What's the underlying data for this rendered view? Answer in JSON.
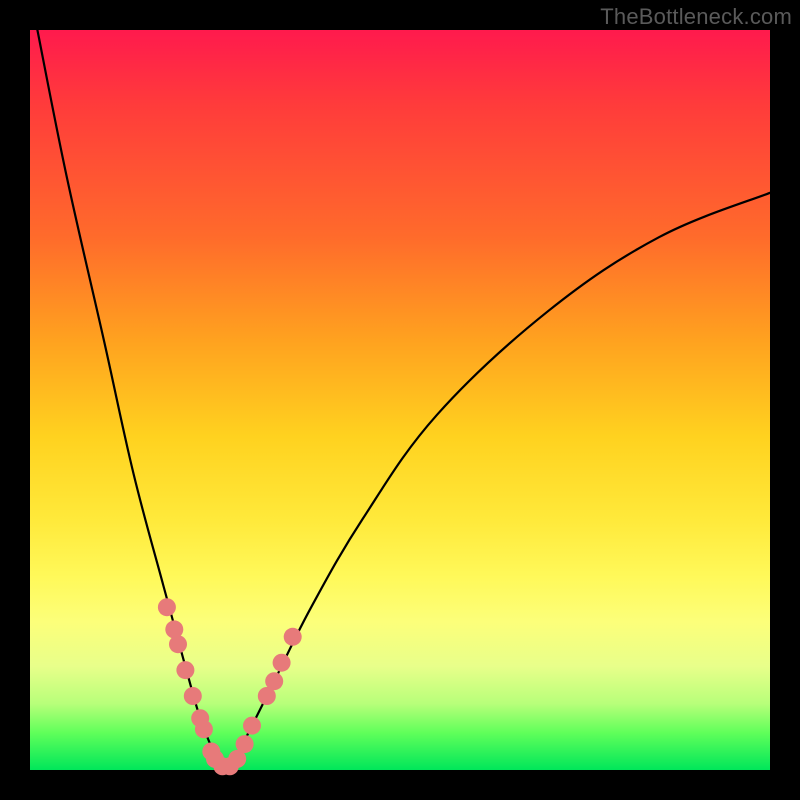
{
  "watermark": "TheBottleneck.com",
  "colors": {
    "frame": "#000000",
    "curve": "#000000",
    "marker": "#e77a7a",
    "marker_stroke": "#d86a6a"
  },
  "chart_data": {
    "type": "line",
    "title": "",
    "xlabel": "",
    "ylabel": "",
    "xlim": [
      0,
      100
    ],
    "ylim": [
      0,
      100
    ],
    "note": "Black V-shaped curve on a vertical red→green gradient (bottleneck chart). Coral markers cluster around the minimum. Y=0 at bottom (green/optimal), Y=100 at top (red).",
    "series": [
      {
        "name": "bottleneck-curve",
        "x": [
          1,
          5,
          10,
          14,
          18,
          21,
          23,
          25,
          26,
          27,
          28,
          30,
          33,
          38,
          45,
          55,
          70,
          85,
          100
        ],
        "values": [
          100,
          80,
          58,
          40,
          25,
          14,
          7,
          2,
          0,
          0,
          2,
          6,
          12,
          22,
          34,
          48,
          62,
          72,
          78
        ]
      }
    ],
    "markers": {
      "name": "highlighted-points",
      "x": [
        18.5,
        19.5,
        20.0,
        21.0,
        22.0,
        23.0,
        23.5,
        24.5,
        25.0,
        26.0,
        27.0,
        28.0,
        29.0,
        30.0,
        32.0,
        33.0,
        34.0,
        35.5
      ],
      "values": [
        22.0,
        19.0,
        17.0,
        13.5,
        10.0,
        7.0,
        5.5,
        2.5,
        1.5,
        0.5,
        0.5,
        1.5,
        3.5,
        6.0,
        10.0,
        12.0,
        14.5,
        18.0
      ]
    }
  }
}
